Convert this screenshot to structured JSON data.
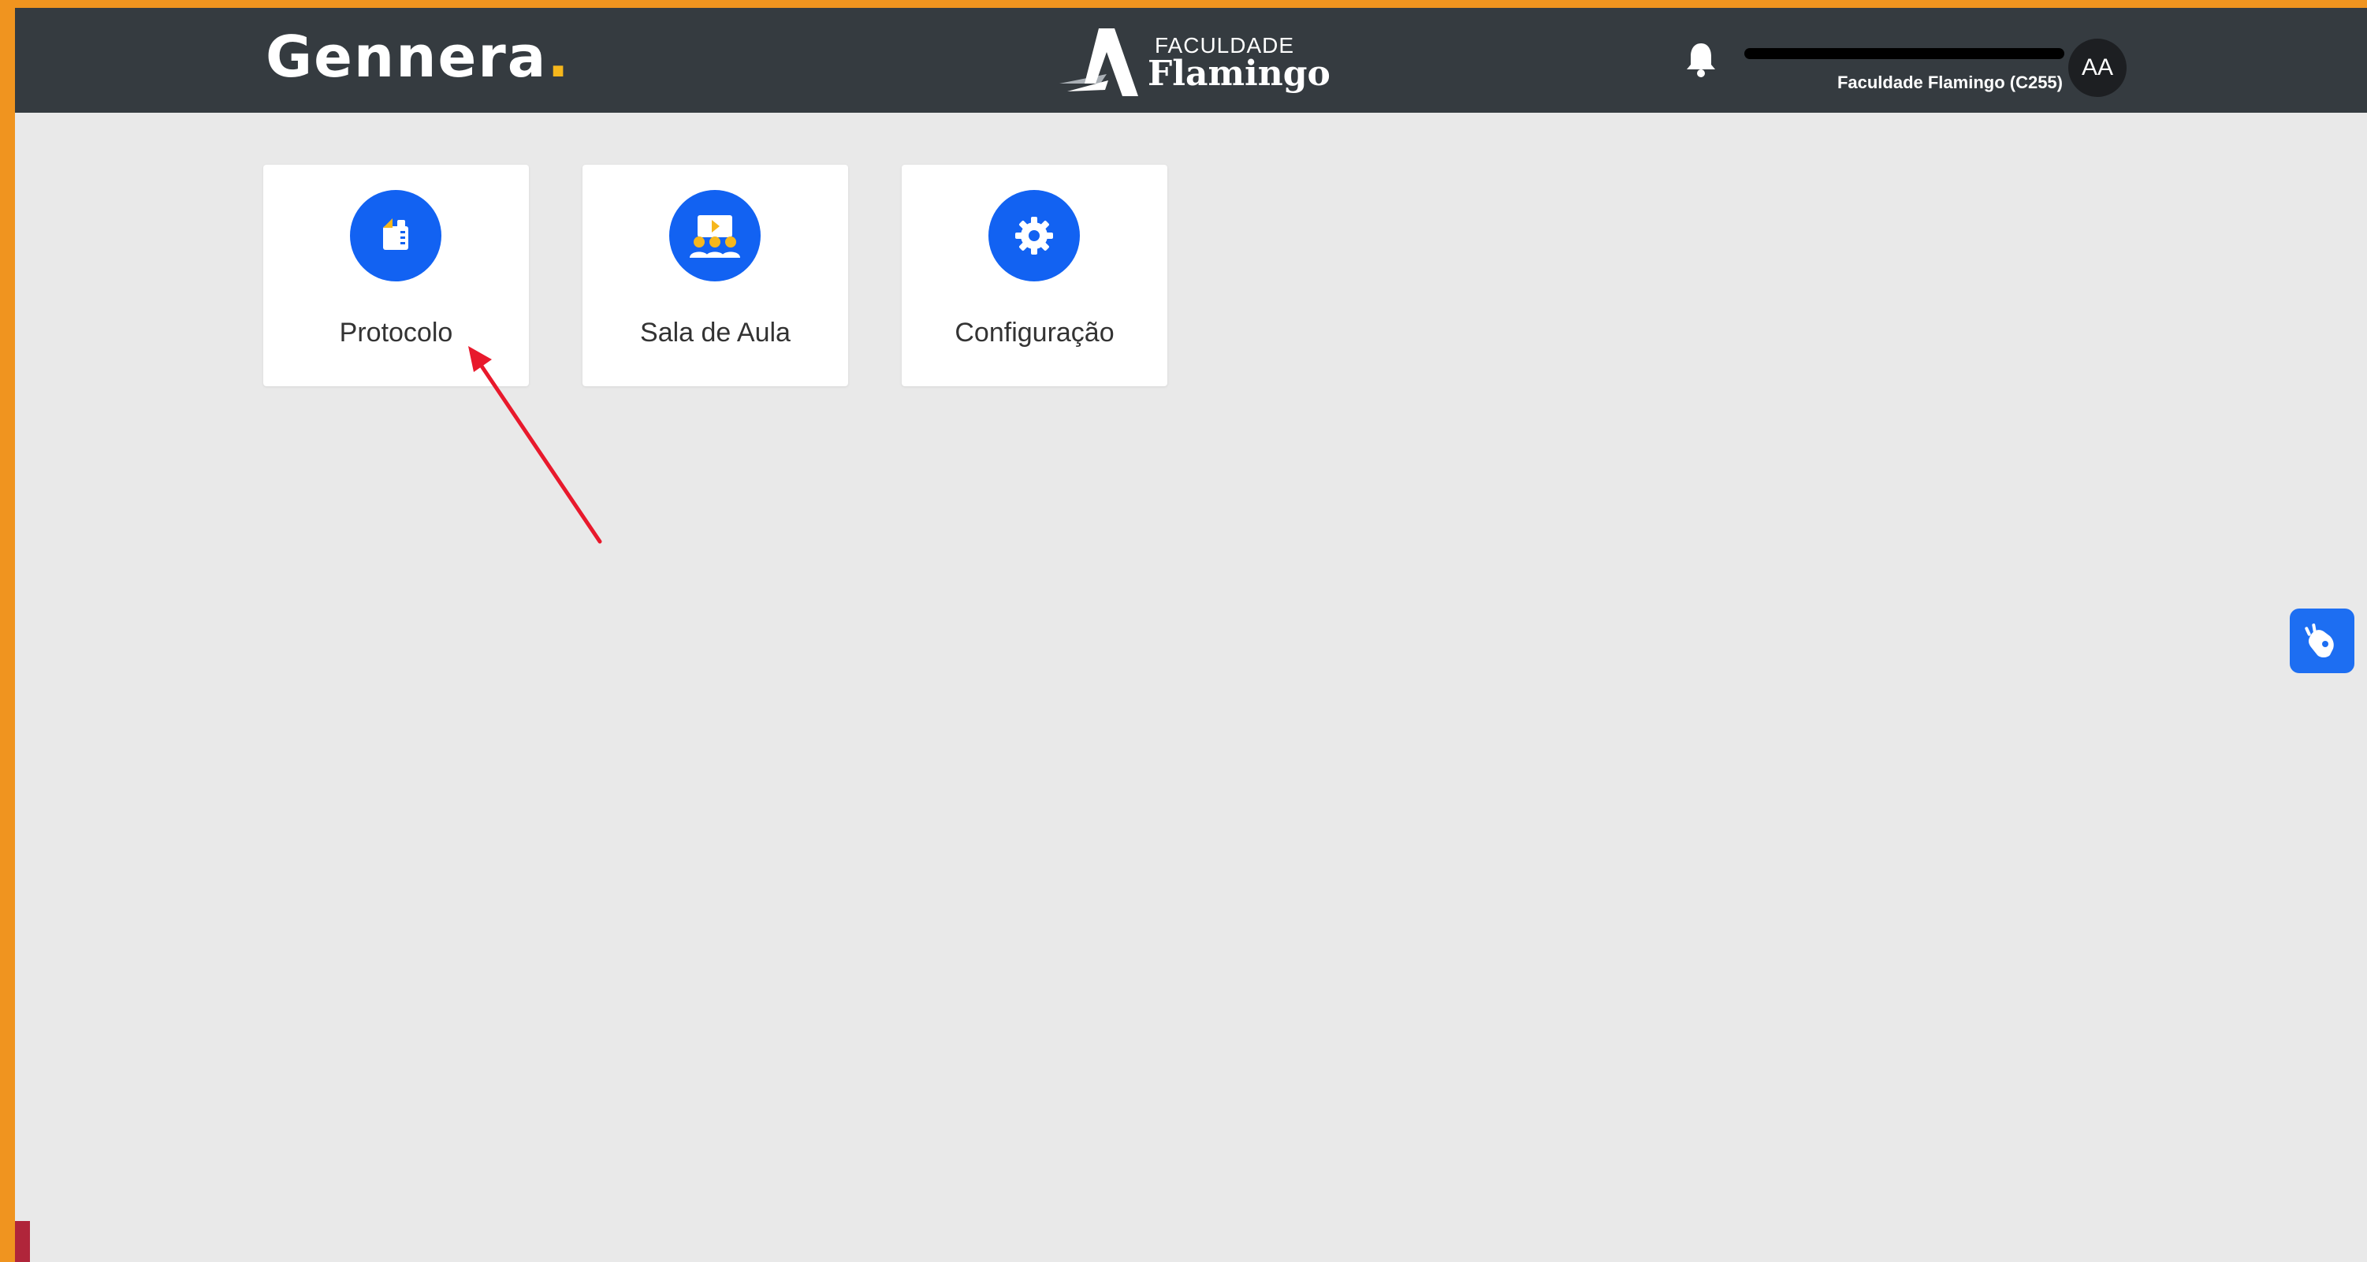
{
  "header": {
    "brand_name": "Gennera",
    "brand_dot": ".",
    "institution_top": "FACULDADE",
    "institution_main": "Flamingo",
    "user_org": "Faculdade Flamingo (C255)",
    "avatar_initials": "AA"
  },
  "modules": [
    {
      "label": "Protocolo",
      "icon": "protocol-icon"
    },
    {
      "label": "Sala de Aula",
      "icon": "classroom-icon"
    },
    {
      "label": "Configuração",
      "icon": "gear-icon"
    }
  ],
  "accessibility": {
    "icon": "sign-language-icon"
  },
  "annotation": {
    "color": "#e8192c"
  },
  "colors": {
    "header_bg": "#353b40",
    "accent": "#1262f2",
    "brand_dot": "#f6b71c",
    "frame": "#f0941f"
  }
}
